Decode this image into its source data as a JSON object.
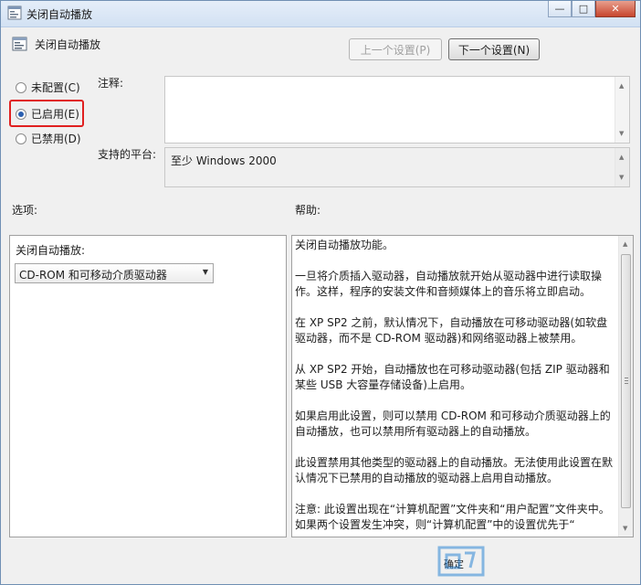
{
  "window": {
    "title": "关闭自动播放",
    "buttons": {
      "minimize": "—",
      "maximize": "□",
      "close": "✕"
    }
  },
  "header": {
    "setting_title": "关闭自动播放",
    "prev_button": "上一个设置(P)",
    "next_button": "下一个设置(N)"
  },
  "state": {
    "options": [
      {
        "label": "未配置(C)",
        "checked": false
      },
      {
        "label": "已启用(E)",
        "checked": true
      },
      {
        "label": "已禁用(D)",
        "checked": false
      }
    ]
  },
  "comment": {
    "label": "注释:",
    "value": ""
  },
  "platform": {
    "label": "支持的平台:",
    "value": "至少 Windows 2000"
  },
  "options_section": {
    "label": "选项:",
    "field_label": "关闭自动播放:",
    "selected": "CD-ROM 和可移动介质驱动器"
  },
  "help_section": {
    "label": "帮助:",
    "paragraphs": [
      "关闭自动播放功能。",
      "一旦将介质插入驱动器，自动播放就开始从驱动器中进行读取操作。这样，程序的安装文件和音频媒体上的音乐将立即启动。",
      "在 XP SP2 之前，默认情况下，自动播放在可移动驱动器(如软盘驱动器，而不是 CD-ROM 驱动器)和网络驱动器上被禁用。",
      "从 XP SP2 开始，自动播放也在可移动驱动器(包括 ZIP 驱动器和某些 USB 大容量存储设备)上启用。",
      "如果启用此设置，则可以禁用 CD-ROM 和可移动介质驱动器上的自动播放，也可以禁用所有驱动器上的自动播放。",
      "此设置禁用其他类型的驱动器上的自动播放。无法使用此设置在默认情况下已禁用的自动播放的驱动器上启用自动播放。",
      "注意: 此设置出现在“计算机配置”文件夹和“用户配置”文件夹中。如果两个设置发生冲突，则“计算机配置”中的设置优先于“"
    ]
  },
  "footer": {
    "ok_partial": "确定"
  },
  "colors": {
    "highlight": "#e02020",
    "radio_dot": "#2a5fb0",
    "titlebar": "#d2e1f3"
  }
}
